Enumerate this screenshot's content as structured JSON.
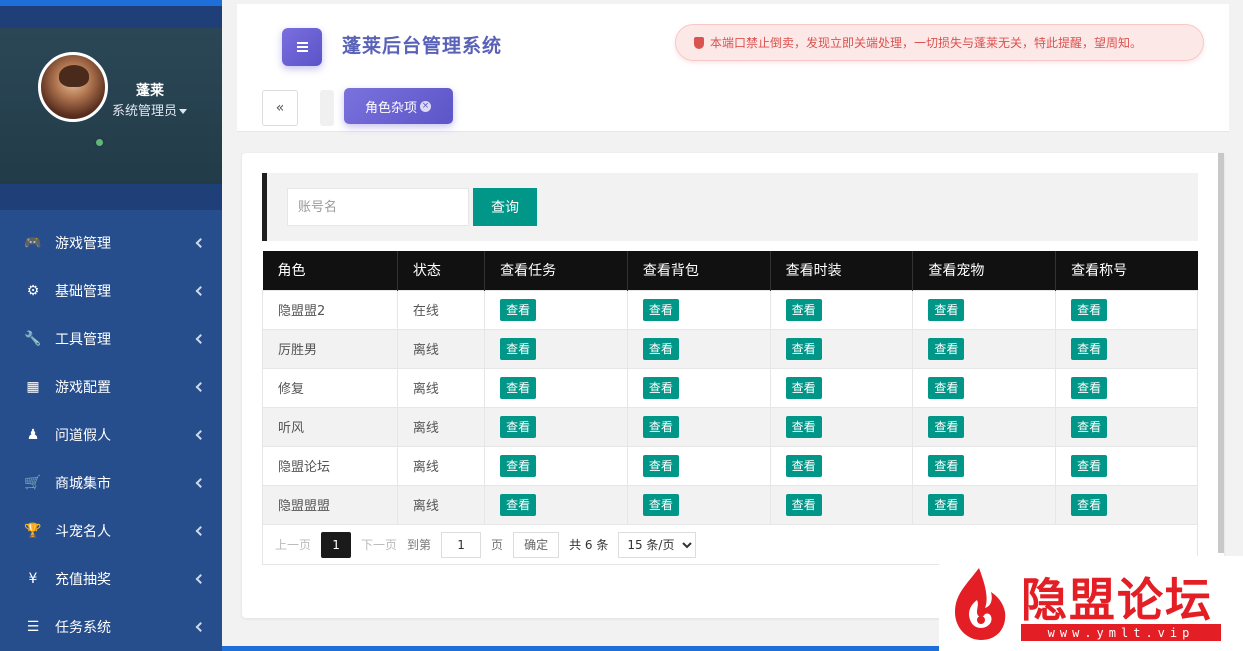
{
  "sidebar": {
    "user": {
      "name": "蓬莱",
      "role": "系统管理员"
    },
    "items": [
      {
        "label": "游戏管理",
        "icon": "gamepad-icon",
        "glyph": "🎮"
      },
      {
        "label": "基础管理",
        "icon": "gear-icon",
        "glyph": "⚙"
      },
      {
        "label": "工具管理",
        "icon": "wrench-icon",
        "glyph": "🔧"
      },
      {
        "label": "游戏配置",
        "icon": "table-icon",
        "glyph": "▦"
      },
      {
        "label": "问道假人",
        "icon": "user-icon",
        "glyph": "♟"
      },
      {
        "label": "商城集市",
        "icon": "cart-icon",
        "glyph": "🛒"
      },
      {
        "label": "斗宠名人",
        "icon": "trophy-icon",
        "glyph": "🏆"
      },
      {
        "label": "充值抽奖",
        "icon": "yen-icon",
        "glyph": "¥"
      },
      {
        "label": "任务系统",
        "icon": "list-icon",
        "glyph": "☰"
      }
    ]
  },
  "header": {
    "title": "蓬莱后台管理系统",
    "notice": "本端口禁止倒卖，发现立即关端处理，一切损失与蓬莱无关，特此提醒，望周知。",
    "collapse_glyph": "«",
    "active_tab": "角色杂项"
  },
  "search": {
    "placeholder": "账号名",
    "button": "查询"
  },
  "table": {
    "columns": [
      "角色",
      "状态",
      "查看任务",
      "查看背包",
      "查看时装",
      "查看宠物",
      "查看称号"
    ],
    "view_label": "查看",
    "rows": [
      {
        "role": "隐盟盟2",
        "status": "在线",
        "online": true
      },
      {
        "role": "厉胜男",
        "status": "离线",
        "online": false
      },
      {
        "role": "修复",
        "status": "离线",
        "online": false
      },
      {
        "role": "听风",
        "status": "离线",
        "online": false
      },
      {
        "role": "隐盟论坛",
        "status": "离线",
        "online": false
      },
      {
        "role": "隐盟盟盟",
        "status": "离线",
        "online": false
      }
    ]
  },
  "pager": {
    "prev": "上一页",
    "current": "1",
    "next": "下一页",
    "goto_label": "到第",
    "goto_value": "1",
    "page_unit": "页",
    "confirm": "确定",
    "total": "共 6 条",
    "per_page": "15 条/页"
  },
  "watermark": {
    "title": "隐盟论坛",
    "url": "www.ymlt.vip"
  },
  "colors": {
    "sidebar": "#264d8c",
    "accent": "#009688",
    "title": "#5a62b8",
    "notice": "#d9534f",
    "watermark": "#e31e24"
  }
}
